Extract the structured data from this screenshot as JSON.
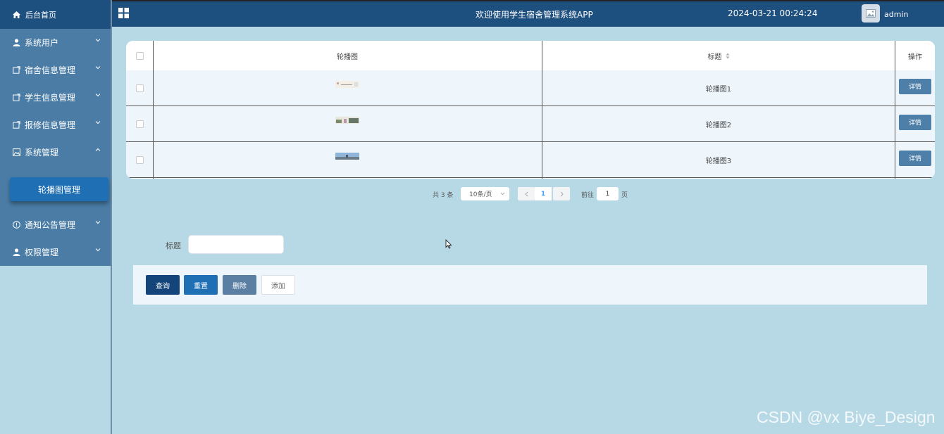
{
  "sidebar": {
    "home_label": "后台首页",
    "items": [
      {
        "label": "系统用户",
        "icon": "user-icon",
        "expanded": false
      },
      {
        "label": "宿舍信息管理",
        "icon": "tag-icon",
        "expanded": false
      },
      {
        "label": "学生信息管理",
        "icon": "tag-icon",
        "expanded": false
      },
      {
        "label": "报修信息管理",
        "icon": "tag-icon",
        "expanded": false
      },
      {
        "label": "系统管理",
        "icon": "image-icon",
        "expanded": true
      },
      {
        "label": "通知公告管理",
        "icon": "info-icon",
        "expanded": false
      },
      {
        "label": "权限管理",
        "icon": "user-icon",
        "expanded": false
      }
    ],
    "active_sub": "轮播图管理"
  },
  "topbar": {
    "title": "欢迎使用学生宿舍管理系统APP",
    "datetime": "2024-03-21 00:24:24",
    "username": "admin"
  },
  "table": {
    "headers": {
      "image": "轮播图",
      "title": "标题",
      "action": "操作"
    },
    "rows": [
      {
        "title": "轮播图1",
        "action": "详情"
      },
      {
        "title": "轮播图2",
        "action": "详情"
      },
      {
        "title": "轮播图3",
        "action": "详情"
      }
    ]
  },
  "pagination": {
    "total": "共 3 条",
    "page_size": "10条/页",
    "current": "1",
    "goto_label": "前往",
    "goto_value": "1",
    "page_suffix": "页"
  },
  "search": {
    "label": "标题",
    "value": ""
  },
  "actions": {
    "query": "查询",
    "reset": "重置",
    "delete": "删除",
    "add": "添加"
  },
  "watermark": "CSDN @vx Biye_Design",
  "colors": {
    "primary": "#1d4f7f",
    "menu": "#4a7ca5",
    "background": "#b7d9e6",
    "accent": "#1f6fb5"
  }
}
